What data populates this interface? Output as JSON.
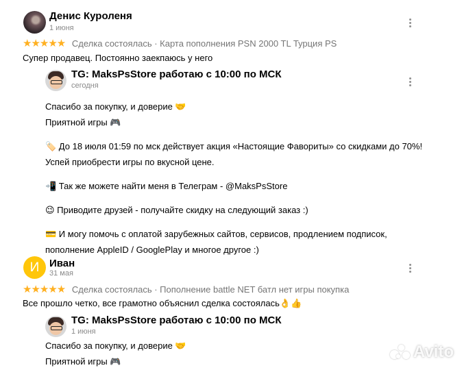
{
  "reviews": [
    {
      "author": "Денис Куроленя",
      "date": "1 июня",
      "stars": "★★★★★",
      "deal_text": "Сделка состоялась · Карта пополнения PSN 2000 TL Турция PS",
      "text": "Супер продавец. Постоянно заекпаюсь у него",
      "reply": {
        "author": "TG: MaksPsStore работаю с 10:00 по МСК",
        "date": "сегодня",
        "lines": [
          "Спасибо за покупку, и доверие 🤝",
          "Приятной игры 🎮",
          "",
          "🏷️ До 18 июля 01:59 по мск действует акция «Настоящие Фавориты» со скидками до 70%!",
          "Успей приобрести игры по вкусной цене.",
          "",
          "📲 Так же можете найти меня в Телеграм - @MaksPsStore",
          "",
          "😉 Приводите друзей - получайте скидку на следующий заказ :)",
          "",
          "💳 И могу помочь с оплатой зарубежных сайтов, сервисов, продлением подписок,",
          "пополнение AppleID / GooglePlay и многое другое :)"
        ]
      }
    },
    {
      "author": "Иван",
      "avatar_letter": "И",
      "date": "31 мая",
      "stars": "★★★★★",
      "deal_text": "Сделка состоялась · Пополнение battle NET батл нет игры покупка",
      "text": "Все прошло четко, все грамотно объяснил сделка состоялась👌👍",
      "reply": {
        "author": "TG: MaksPsStore работаю с 10:00 по МСК",
        "date": "1 июня",
        "lines": [
          "Спасибо за покупку, и доверие 🤝",
          "Приятной игры 🎮"
        ]
      }
    }
  ],
  "watermark": "Avito",
  "colors": {
    "star": "#ffb021",
    "avatar_letter_bg": "#ffc60a",
    "muted_text": "#8a8a8a"
  }
}
